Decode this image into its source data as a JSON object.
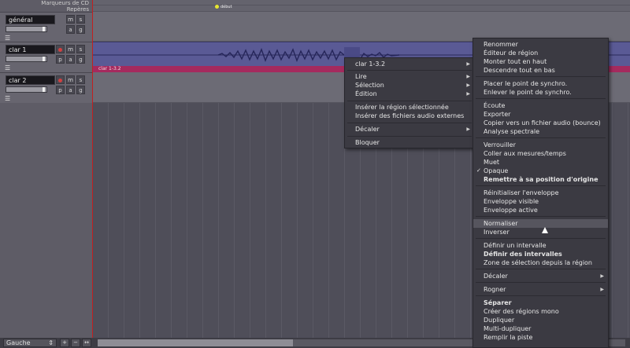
{
  "ruler": {
    "cd_markers_label": "Marqueurs de CD",
    "markers_label": "Repères",
    "marker_start_label": "début"
  },
  "tracks": [
    {
      "name": "général",
      "buttons": [
        "m",
        "s",
        "a",
        "g"
      ]
    },
    {
      "name": "clar 1",
      "buttons": [
        "m",
        "s",
        "p",
        "a",
        "g"
      ]
    },
    {
      "name": "clar 2",
      "buttons": [
        "m",
        "s",
        "p",
        "a",
        "g"
      ]
    }
  ],
  "region": {
    "name": "clar 1-3.2"
  },
  "bottom": {
    "zoom_focus": "Gauche"
  },
  "context_menu": {
    "items": [
      {
        "label": "clar 1-3.2",
        "submenu": true
      },
      {
        "label": "Lire",
        "submenu": true
      },
      {
        "label": "Sélection",
        "submenu": true
      },
      {
        "label": "Édition",
        "submenu": true
      },
      {
        "label": "Insérer la région sélectionnée"
      },
      {
        "label": "Insérer des fichiers audio externes"
      },
      {
        "label": "Décaler",
        "submenu": true
      },
      {
        "label": "Bloquer"
      }
    ]
  },
  "region_menu": {
    "items": [
      {
        "label": "Renommer"
      },
      {
        "label": "Éditeur de région"
      },
      {
        "label": "Monter tout en haut"
      },
      {
        "label": "Descendre tout en bas"
      },
      {
        "label": "Placer le point de synchro."
      },
      {
        "label": "Enlever le point de synchro."
      },
      {
        "label": "Écoute"
      },
      {
        "label": "Exporter"
      },
      {
        "label": "Copier vers un fichier audio (bounce)"
      },
      {
        "label": "Analyse spectrale"
      },
      {
        "label": "Verrouiller"
      },
      {
        "label": "Coller aux mesures/temps"
      },
      {
        "label": "Muet"
      },
      {
        "label": "Opaque",
        "checked": true
      },
      {
        "label": "Remettre à sa position d'origine",
        "bold": true
      },
      {
        "label": "Réinitialiser l'enveloppe"
      },
      {
        "label": "Enveloppe visible"
      },
      {
        "label": "Enveloppe active"
      },
      {
        "label": "Normaliser",
        "highlighted": true
      },
      {
        "label": "Inverser"
      },
      {
        "label": "Définir un intervalle"
      },
      {
        "label": "Définir des intervalles",
        "bold": true
      },
      {
        "label": "Zone de sélection depuis la région"
      },
      {
        "label": "Décaler",
        "submenu": true
      },
      {
        "label": "Rogner",
        "submenu": true
      },
      {
        "label": "Séparer",
        "bold": true
      },
      {
        "label": "Créer des régions mono"
      },
      {
        "label": "Dupliquer"
      },
      {
        "label": "Multi-dupliquer"
      },
      {
        "label": "Remplir la piste"
      }
    ]
  },
  "colors": {
    "region_fill": "#5a5a95",
    "region_name_bar": "#a52a5e",
    "playhead": "#c02020",
    "menu_bg": "#3b3a42",
    "menu_highlight": "#56555e"
  }
}
